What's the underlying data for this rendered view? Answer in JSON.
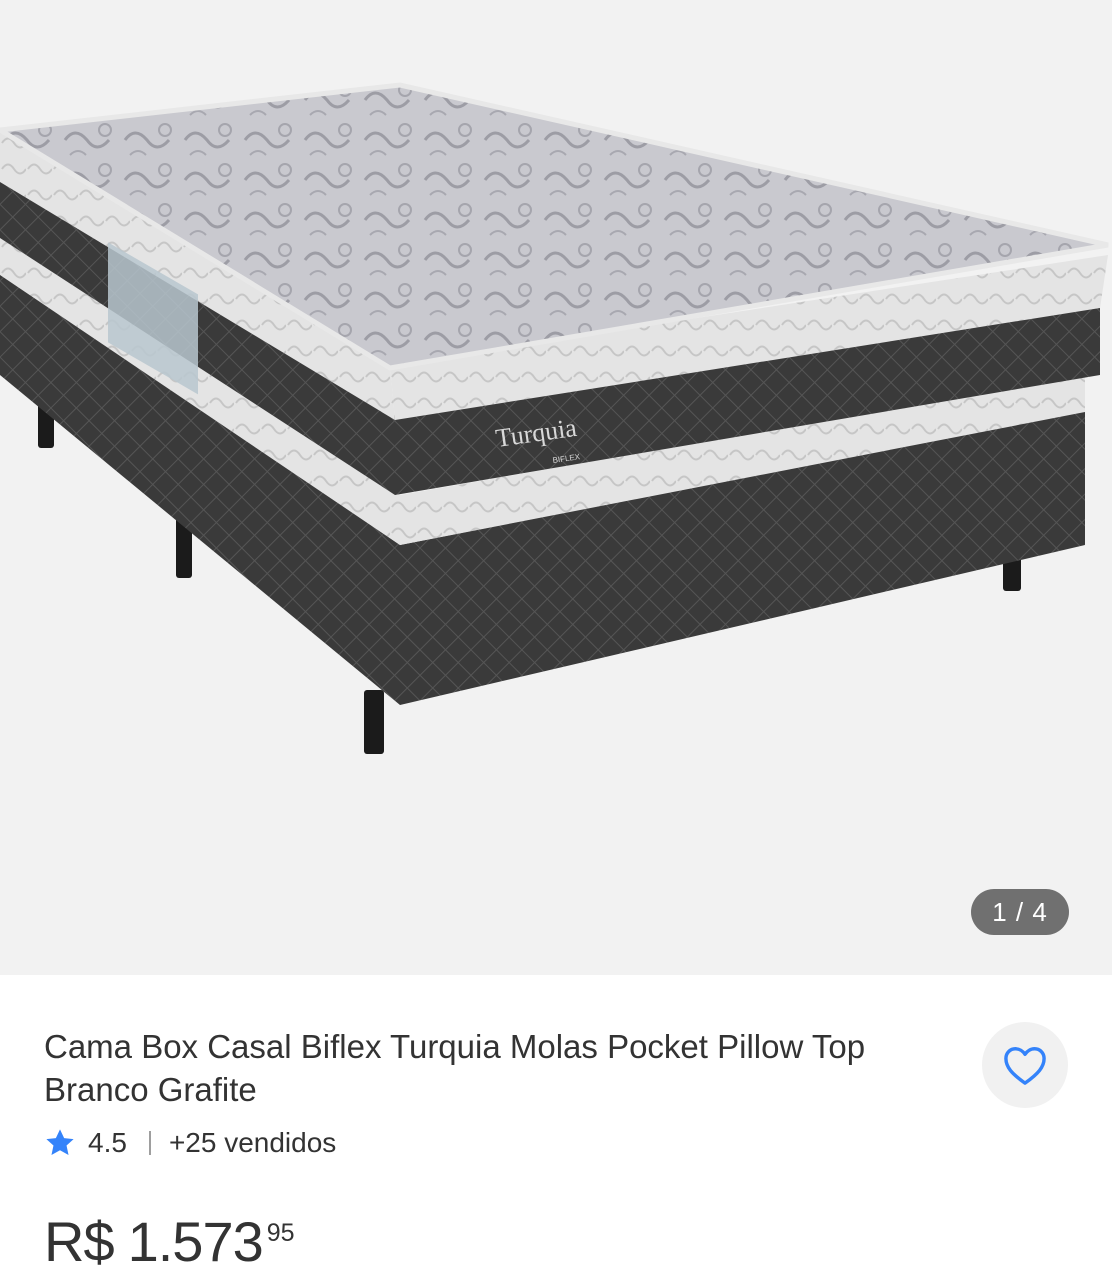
{
  "gallery": {
    "image_alt": "Cama Box Casal Biflex Turquia",
    "label_brand": "Turquia",
    "label_sub": "BIFLEX",
    "counter": "1 / 4"
  },
  "product": {
    "title": "Cama Box Casal Biflex Turquia Molas Pocket Pillow Top Branco Grafite",
    "rating": "4.5",
    "sold": "+25 vendidos",
    "price_currency": "R$",
    "price_integer": "1.573",
    "price_cents": "95"
  },
  "colors": {
    "accent": "#3483fa",
    "text": "#333333",
    "counter_bg": "#707070",
    "gallery_bg": "#f2f2f2"
  },
  "icons": {
    "favorite": "heart-outline-icon",
    "rating": "star-icon"
  }
}
